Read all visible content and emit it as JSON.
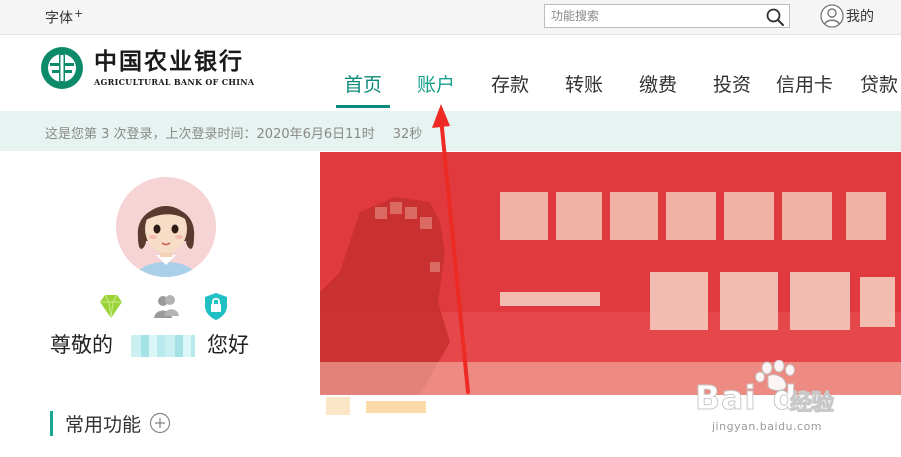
{
  "topbar": {
    "font_label": "字体",
    "font_plus": "+",
    "search_placeholder": "功能搜索",
    "my_label": "我的"
  },
  "logo": {
    "name_cn": "中国农业银行",
    "name_en": "AGRICULTURAL BANK OF CHINA"
  },
  "nav": {
    "items": [
      {
        "label": "首页",
        "state": "active"
      },
      {
        "label": "账户",
        "state": "hover"
      },
      {
        "label": "存款",
        "state": "normal"
      },
      {
        "label": "转账",
        "state": "normal"
      },
      {
        "label": "缴费",
        "state": "normal"
      },
      {
        "label": "投资",
        "state": "normal"
      },
      {
        "label": "信用卡",
        "state": "normal"
      },
      {
        "label": "贷款",
        "state": "normal"
      }
    ]
  },
  "login_info": "这是您第 3 次登录，上次登录时间：2020年6月6日11时",
  "login_info_tail": "32秒",
  "user": {
    "greeting_prefix": "尊敬的",
    "greeting_suffix": "您好",
    "badges": [
      "diamond-icon",
      "group-icon",
      "lock-shield-icon"
    ]
  },
  "common_functions": {
    "title": "常用功能"
  },
  "watermark": {
    "brand": "Bai",
    "brand2": "du",
    "cn": "经验",
    "url": "jingyan.baidu.com"
  },
  "colors": {
    "brand_green": "#0d8a7a",
    "nav_hover": "#18a08c",
    "login_bar": "#e6f3f1",
    "banner_red": "#e03a3e",
    "arrow_red": "#ee2a24"
  }
}
